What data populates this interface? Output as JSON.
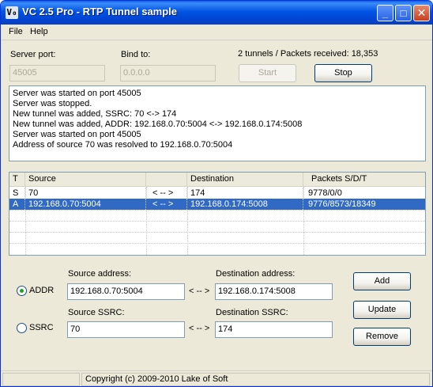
{
  "window": {
    "title": "VC 2.5 Pro - RTP Tunnel sample",
    "icon_text": "V₀"
  },
  "titlebar": {
    "minimize": "_",
    "maximize": "□",
    "close": "✕"
  },
  "menu": {
    "file": "File",
    "help": "Help"
  },
  "server": {
    "port_label": "Server port:",
    "port_value": "45005",
    "bind_label": "Bind to:",
    "bind_value": "0.0.0.0",
    "stats": "2 tunnels / Packets received: 18,353",
    "start_label": "Start",
    "stop_label": "Stop"
  },
  "log": [
    "Server was started on port 45005",
    "Server was stopped.",
    "New tunnel was added, SSRC: 70 <-> 174",
    "New tunnel was added, ADDR: 192.168.0.70:5004 <-> 192.168.0.174:5008",
    "Server was started on port 45005",
    "Address of source 70 was resolved to 192.168.0.70:5004"
  ],
  "table": {
    "headers": [
      "T",
      "Source",
      "",
      "Destination",
      "Packets S/D/T"
    ],
    "rows": [
      [
        "S",
        "70",
        "< -- >",
        "174",
        "9778/0/0"
      ],
      [
        "A",
        "192.168.0.70:5004",
        "< -- >",
        "192.168.0.174:5008",
        "9776/8573/18349"
      ]
    ]
  },
  "form": {
    "addr_radio": "ADDR",
    "ssrc_radio": "SSRC",
    "src_addr_label": "Source address:",
    "src_addr_value": "192.168.0.70:5004",
    "dst_addr_label": "Destination address:",
    "dst_addr_value": "192.168.0.174:5008",
    "src_ssrc_label": "Source SSRC:",
    "src_ssrc_value": "70",
    "dst_ssrc_label": "Destination SSRC:",
    "dst_ssrc_value": "174",
    "arrow": "< -- >",
    "add_label": "Add",
    "update_label": "Update",
    "remove_label": "Remove"
  },
  "status": {
    "copyright": "Copyright (c) 2009-2010 Lake of Soft"
  },
  "colors": {
    "titlebar": "#0054e3",
    "selection": "#316ac5",
    "face": "#ece9d8"
  }
}
